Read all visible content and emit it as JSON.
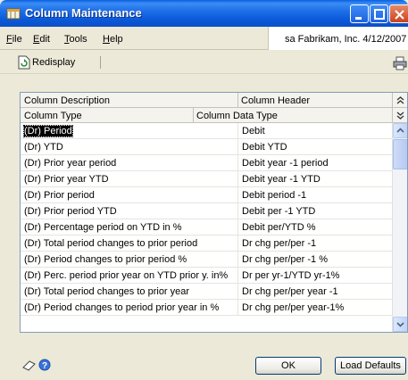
{
  "window": {
    "title": "Column Maintenance"
  },
  "menu": {
    "items": [
      {
        "label": "File",
        "mnemonic": "F",
        "rest": "ile"
      },
      {
        "label": "Edit",
        "mnemonic": "E",
        "rest": "dit"
      },
      {
        "label": "Tools",
        "mnemonic": "T",
        "rest": "ools"
      },
      {
        "label": "Help",
        "mnemonic": "H",
        "rest": "elp"
      }
    ],
    "company": "sa  Fabrikam, Inc.  4/12/2007"
  },
  "toolbar": {
    "redisplay_label": "Redisplay"
  },
  "grid": {
    "header1": {
      "col1": "Column Description",
      "col2": "Column Header"
    },
    "header2": {
      "col1": "Column Type",
      "col2": "Column Data Type"
    },
    "rows": [
      {
        "desc": "(Dr) Period",
        "header": "Debit",
        "selected": true
      },
      {
        "desc": "(Dr)  YTD",
        "header": "Debit YTD"
      },
      {
        "desc": "(Dr)  Prior year period",
        "header": "Debit year -1 period"
      },
      {
        "desc": "(Dr)  Prior year YTD",
        "header": "Debit year -1 YTD"
      },
      {
        "desc": "(Dr)  Prior period",
        "header": "Debit period -1"
      },
      {
        "desc": "(Dr)  Prior period YTD",
        "header": "Debit per -1 YTD"
      },
      {
        "desc": "(Dr)  Percentage period on YTD in %",
        "header": "Debit per/YTD %"
      },
      {
        "desc": "(Dr)  Total period changes to prior period",
        "header": "Dr chg per/per -1"
      },
      {
        "desc": "(Dr)  Period changes to prior period %",
        "header": "Dr chg per/per -1 %"
      },
      {
        "desc": "(Dr)  Perc. period prior year on YTD prior y. in%",
        "header": "Dr per yr-1/YTD yr-1%"
      },
      {
        "desc": "(Dr)  Total period changes to prior year",
        "header": "Dr chg per/per year -1"
      },
      {
        "desc": "(Dr)  Period changes to period prior year in %",
        "header": "Dr chg per/per year-1%"
      }
    ]
  },
  "footer": {
    "ok_label": "OK",
    "load_defaults_label": "Load Defaults"
  }
}
